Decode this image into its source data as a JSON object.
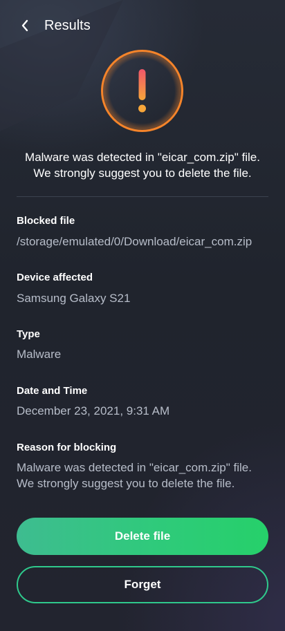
{
  "header": {
    "title": "Results"
  },
  "alert": {
    "icon": "exclamation-icon",
    "message_line1": "Malware was detected in \"eicar_com.zip\" file.",
    "message_line2": "We strongly suggest you to delete the file."
  },
  "details": [
    {
      "label": "Blocked file",
      "value": "/storage/emulated/0/Download/eicar_com.zip"
    },
    {
      "label": "Device affected",
      "value": "Samsung Galaxy S21"
    },
    {
      "label": "Type",
      "value": "Malware"
    },
    {
      "label": "Date and Time",
      "value": "December 23, 2021, 9:31 AM"
    },
    {
      "label": "Reason for blocking",
      "value_line1": "Malware was detected in \"eicar_com.zip\" file.",
      "value_line2": "We strongly suggest you to delete the file."
    }
  ],
  "actions": {
    "delete_label": "Delete file",
    "forget_label": "Forget"
  },
  "colors": {
    "accent_green": "#2fca7b",
    "alert_orange": "#f5842a",
    "alert_gradient_top": "#f0566a",
    "alert_gradient_bottom": "#f7a63a"
  }
}
